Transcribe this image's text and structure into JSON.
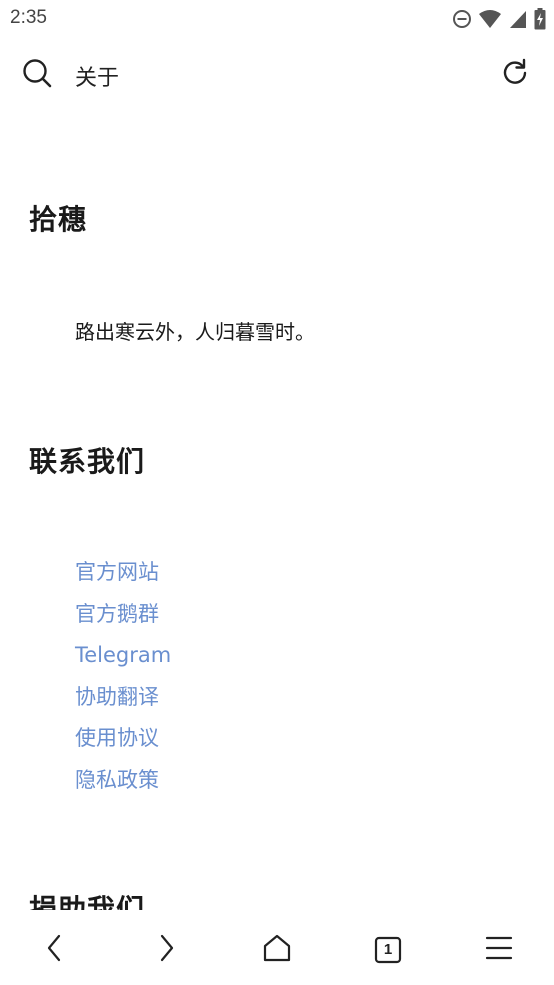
{
  "status_bar": {
    "time": "2:35",
    "icons": [
      "do-not-disturb-icon",
      "wifi-icon",
      "signal-icon",
      "battery-charging-icon"
    ]
  },
  "top_bar": {
    "title": "关于",
    "left_icon": "search-icon",
    "right_icon": "refresh-icon"
  },
  "content": {
    "app_name_heading": "拾穗",
    "tagline": "路出寒云外，人归暮雪时。",
    "contact_heading": "联系我们",
    "links": [
      {
        "label": "官方网站"
      },
      {
        "label": "官方鹅群"
      },
      {
        "label": "Telegram"
      },
      {
        "label": "协助翻译"
      },
      {
        "label": "使用协议"
      },
      {
        "label": "隐私政策"
      }
    ],
    "donate_heading": "捐助我们"
  },
  "bottom_nav": {
    "tab_count": "1",
    "icons": [
      "back-icon",
      "forward-icon",
      "home-icon",
      "tabs-icon",
      "menu-icon"
    ]
  },
  "colors": {
    "link": "#6a8fcf",
    "text": "#1a1a1a",
    "background": "#ffffff"
  }
}
